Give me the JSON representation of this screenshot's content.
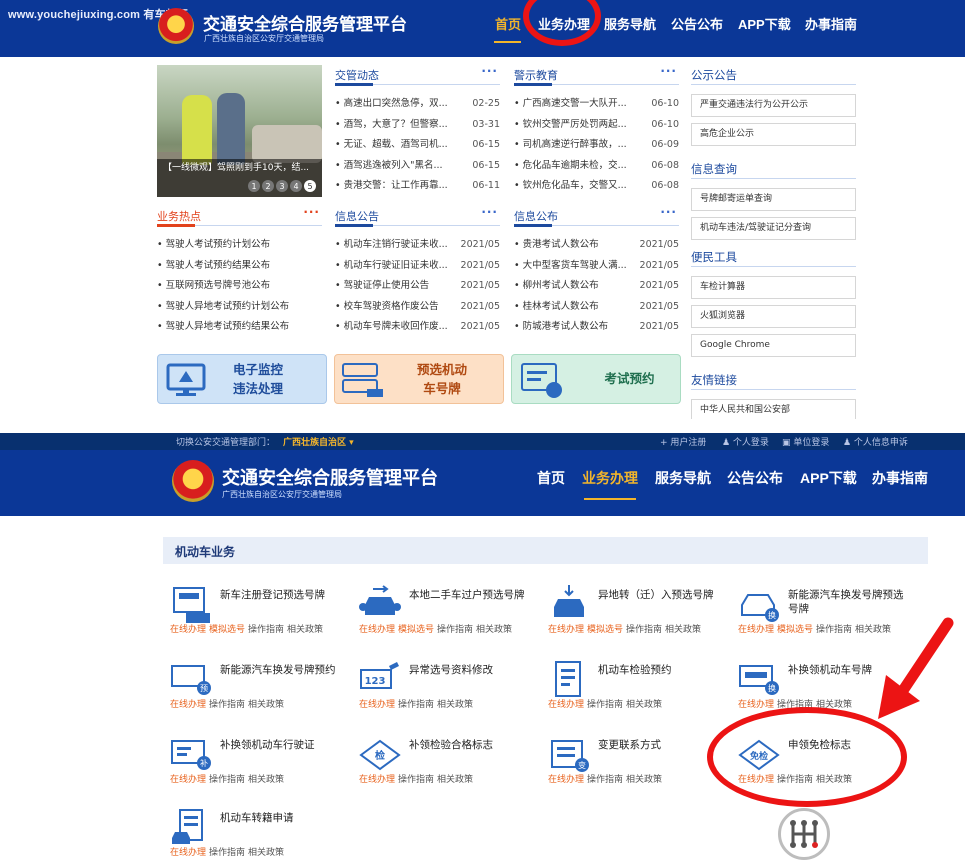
{
  "watermark": "www.youchejiuxing.com 有车就行",
  "top": {
    "title": "交通安全综合服务管理平台",
    "subtitle": "广西壮族自治区公安厅交通管理局",
    "nav": [
      "首页",
      "业务办理",
      "服务导航",
      "公告公布",
      "APP下载",
      "办事指南"
    ],
    "photo": {
      "caption": "【一线微观】驾照刚到手10天，结...",
      "pages": [
        "1",
        "2",
        "3",
        "4",
        "5"
      ]
    },
    "more": "···",
    "traffic_news": {
      "title": "交管动态",
      "items": [
        {
          "t": "• 高速出口突然急停，双...",
          "d": "02-25"
        },
        {
          "t": "• 酒驾，大意了？但警察...",
          "d": "03-31"
        },
        {
          "t": "• 无证、超载、酒驾司机...",
          "d": "06-15"
        },
        {
          "t": "• 酒驾逃逸被列入\"黑名...",
          "d": "06-15"
        },
        {
          "t": "• 贵港交警：让工作再靠...",
          "d": "06-11"
        }
      ]
    },
    "warning": {
      "title": "警示教育",
      "items": [
        {
          "t": "• 广西高速交警一大队开...",
          "d": "06-10"
        },
        {
          "t": "• 钦州交警严厉处罚两起...",
          "d": "06-10"
        },
        {
          "t": "• 司机高速逆行醉事故，...",
          "d": "06-09"
        },
        {
          "t": "• 危化品车逾期未检，交...",
          "d": "06-08"
        },
        {
          "t": "• 钦州危化品车，交警又...",
          "d": "06-08"
        }
      ]
    },
    "hot": {
      "title": "业务热点",
      "items": [
        "• 驾驶人考试预约计划公布",
        "• 驾驶人考试预约结果公布",
        "• 互联网预选号牌号池公布",
        "• 驾驶人异地考试预约计划公布",
        "• 驾驶人异地考试预约结果公布"
      ]
    },
    "info": {
      "title": "信息公告",
      "items": [
        {
          "t": "• 机动车注销行驶证未收...",
          "d": "2021/05"
        },
        {
          "t": "• 机动车行驶证旧证未收...",
          "d": "2021/05"
        },
        {
          "t": "• 驾驶证停止使用公告",
          "d": "2021/05"
        },
        {
          "t": "• 校车驾驶资格作废公告",
          "d": "2021/05"
        },
        {
          "t": "• 机动车号牌未收回作废...",
          "d": "2021/05"
        }
      ]
    },
    "publish": {
      "title": "信息公布",
      "items": [
        {
          "t": "• 贵港考试人数公布",
          "d": "2021/05"
        },
        {
          "t": "• 大中型客货车驾驶人满...",
          "d": "2021/05"
        },
        {
          "t": "• 柳州考试人数公布",
          "d": "2021/05"
        },
        {
          "t": "• 桂林考试人数公布",
          "d": "2021/05"
        },
        {
          "t": "• 防城港考试人数公布",
          "d": "2021/05"
        }
      ]
    },
    "side": {
      "notice_title": "公示公告",
      "notice": [
        "严重交通违法行为公开公示",
        "高危企业公示"
      ],
      "query_title": "信息查询",
      "query": [
        "号牌邮寄运单查询",
        "机动车违法/驾驶证记分查询"
      ],
      "tools_title": "便民工具",
      "tools": [
        "车检计算器",
        "火狐浏览器",
        "Google Chrome"
      ],
      "links_title": "友情链接",
      "links": [
        "中华人民共和国公安部"
      ]
    },
    "cards": [
      {
        "line1": "电子监控",
        "line2": "违法处理",
        "bg": "#cfe3f7",
        "fg": "#1f4d9b"
      },
      {
        "line1": "预选机动",
        "line2": "车号牌",
        "bg": "#fde0c6",
        "fg": "#b04a12"
      },
      {
        "line1": "考试预约",
        "line2": "",
        "bg": "#d5f0e3",
        "fg": "#1f6f4f"
      }
    ]
  },
  "bottom": {
    "topbar": {
      "switch_label": "切换公安交通管理部门：",
      "region": "广西壮族自治区 ▾",
      "links": [
        "+ 用户注册",
        "♟ 个人登录",
        "▣ 单位登录",
        "♟ 个人信息申诉"
      ]
    },
    "title": "交通安全综合服务管理平台",
    "subtitle": "广西壮族自治区公安厅交通管理局",
    "nav": [
      "首页",
      "业务办理",
      "服务导航",
      "公告公布",
      "APP下载",
      "办事指南"
    ],
    "band": "机动车业务",
    "services": [
      {
        "name": "新车注册登记预选号牌",
        "links": [
          "在线办理",
          "模拟选号",
          "操作指南",
          "相关政策"
        ]
      },
      {
        "name": "本地二手车过户预选号牌",
        "links": [
          "在线办理",
          "模拟选号",
          "操作指南",
          "相关政策"
        ]
      },
      {
        "name": "异地转（迁）入预选号牌",
        "links": [
          "在线办理",
          "模拟选号",
          "操作指南",
          "相关政策"
        ]
      },
      {
        "name": "新能源汽车换发号牌预选号牌",
        "links": [
          "在线办理",
          "模拟选号",
          "操作指南",
          "相关政策"
        ]
      },
      {
        "name": "新能源汽车换发号牌预约",
        "links": [
          "在线办理",
          "操作指南",
          "相关政策"
        ]
      },
      {
        "name": "异常选号资料修改",
        "links": [
          "在线办理",
          "操作指南",
          "相关政策"
        ]
      },
      {
        "name": "机动车检验预约",
        "links": [
          "在线办理",
          "操作指南",
          "相关政策"
        ]
      },
      {
        "name": "补换领机动车号牌",
        "links": [
          "在线办理",
          "操作指南",
          "相关政策"
        ]
      },
      {
        "name": "补换领机动车行驶证",
        "links": [
          "在线办理",
          "操作指南",
          "相关政策"
        ]
      },
      {
        "name": "补领检验合格标志",
        "links": [
          "在线办理",
          "操作指南",
          "相关政策"
        ]
      },
      {
        "name": "变更联系方式",
        "links": [
          "在线办理",
          "操作指南",
          "相关政策"
        ]
      },
      {
        "name": "申领免检标志",
        "links": [
          "在线办理",
          "操作指南",
          "相关政策"
        ]
      },
      {
        "name": "机动车转籍申请",
        "links": [
          "在线办理",
          "操作指南",
          "相关政策"
        ]
      }
    ],
    "icon_labels": {
      "check": "检",
      "exempt": "免检",
      "plate": "123",
      "tag": "预",
      "swap": "换",
      "fill": "补",
      "change": "变"
    }
  },
  "colors": {
    "header": "#0b3797",
    "accent": "#f2b52c",
    "red_mark": "#ec1414",
    "link_orange": "#e8631f"
  }
}
